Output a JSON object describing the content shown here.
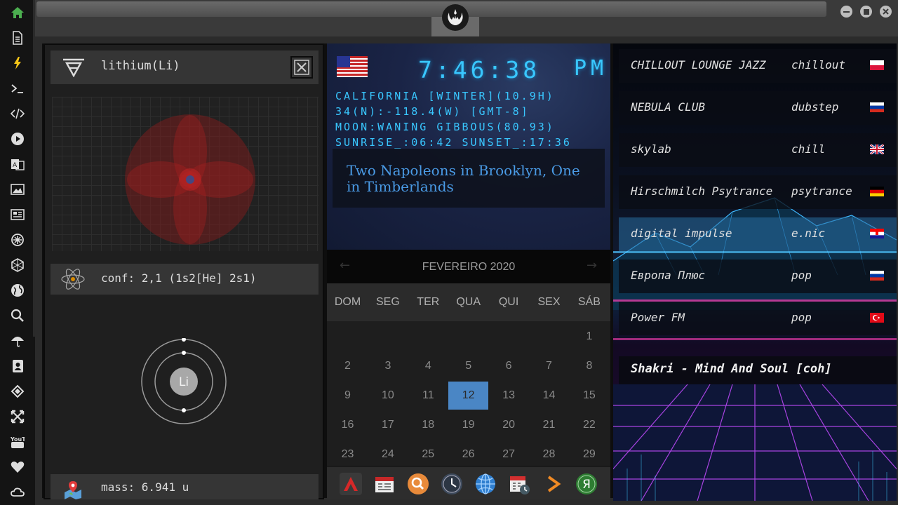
{
  "launcher": {
    "icons": [
      "home-icon",
      "document-icon",
      "bolt-icon",
      "terminal-icon",
      "code-icon",
      "play-icon",
      "translate-icon",
      "image-icon",
      "news-icon",
      "settings-icon",
      "hexagon-icon",
      "globe-icon",
      "search-icon",
      "umbrella-icon",
      "contacts-icon",
      "tag-icon",
      "expand-icon",
      "youtube-icon",
      "heart-icon",
      "cloud-icon"
    ],
    "accent_home": "#4caf50",
    "accent_bolt": "#f5c518",
    "youtube_label": "YouTube"
  },
  "element_panel": {
    "name": "lithium(Li)",
    "configuration": "conf: 2,1 (1s2[He] 2s1)",
    "symbol": "Li",
    "mass": "mass: 6.941 u",
    "orbital_color": "#d32f2f"
  },
  "clock": {
    "time": "7:46:38",
    "ampm": "PM",
    "lines": [
      "CALIFORNIA [WINTER](10.9H)",
      "34(N):-118.4(W) [GMT-8]",
      "MOON:WANING GIBBOUS(80.93)",
      "SUNRISE_:06:42 SUNSET_:17:36"
    ],
    "quote": "Two Napoleons in Brooklyn, One in Timberlands",
    "text_color": "#39c7ff"
  },
  "calendar": {
    "title": "FEVEREIRO 2020",
    "prev": "←",
    "next": "→",
    "weekdays": [
      "DOM",
      "SEG",
      "TER",
      "QUA",
      "QUI",
      "SEX",
      "SÁB"
    ],
    "weeks": [
      [
        "",
        "",
        "",
        "",
        "",
        "",
        "1"
      ],
      [
        "2",
        "3",
        "4",
        "5",
        "6",
        "7",
        "8"
      ],
      [
        "9",
        "10",
        "11",
        "12",
        "13",
        "14",
        "15"
      ],
      [
        "16",
        "17",
        "18",
        "19",
        "20",
        "21",
        "22"
      ],
      [
        "23",
        "24",
        "25",
        "26",
        "27",
        "28",
        "29"
      ]
    ],
    "today": "12",
    "today_color": "#4a86c5"
  },
  "dock": {
    "apps": [
      "alpha-app-icon",
      "calendar-app-icon",
      "search-app-icon",
      "clock-app-icon",
      "globe-app-icon",
      "schedule-app-icon",
      "play-app-icon",
      "yandex-app-icon"
    ],
    "yandex_letter": "Я"
  },
  "radio": {
    "stations": [
      {
        "name": "CHILLOUT LOUNGE JAZZ",
        "genre": "chillout",
        "flag": "flag-poland-icon"
      },
      {
        "name": "NEBULA CLUB",
        "genre": "dubstep",
        "flag": "flag-russia-icon"
      },
      {
        "name": "skylab",
        "genre": "chill",
        "flag": "flag-uk-icon"
      },
      {
        "name": "Hirschmilch Psytrance",
        "genre": "psytrance",
        "flag": "flag-germany-icon"
      },
      {
        "name": "digital impulse",
        "genre": "e.nic",
        "flag": "flag-croatia-icon"
      },
      {
        "name": "Европа Плюс",
        "genre": "pop",
        "flag": "flag-russia-icon"
      },
      {
        "name": "Power FM",
        "genre": "pop",
        "flag": "flag-turkey-icon"
      }
    ],
    "now_playing": "Shakri - Mind And Soul [coh]",
    "highlight_index": 4
  }
}
